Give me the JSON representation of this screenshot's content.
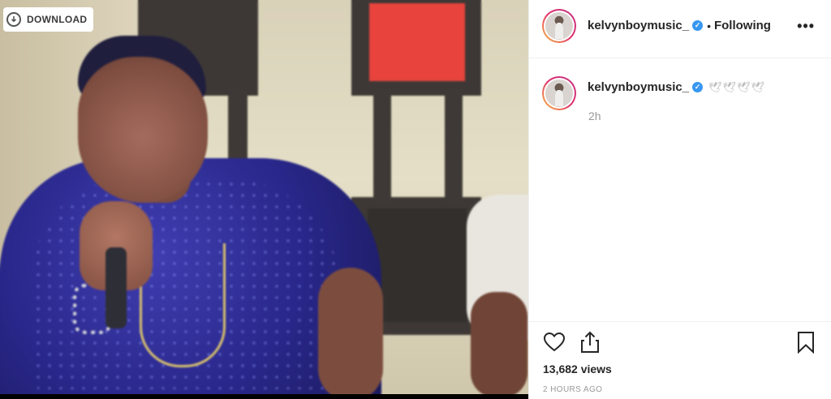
{
  "media": {
    "download_label": "DOWNLOAD"
  },
  "post": {
    "author": "kelvynboymusic_",
    "verified_mark": "✓",
    "separator": "•",
    "follow_status": "Following",
    "more_options": "•••"
  },
  "caption": {
    "author": "kelvynboymusic_",
    "verified_mark": "✓",
    "text": "🕊🕊🕊🕊",
    "time": "2h"
  },
  "actions": {
    "like_icon": "heart-icon",
    "share_icon": "share-icon",
    "save_icon": "bookmark-icon"
  },
  "stats": {
    "views": "13,682 views",
    "posted_ago": "2 HOURS AGO"
  },
  "colors": {
    "verified": "#3897f0",
    "text": "#262626",
    "muted": "#999999"
  }
}
